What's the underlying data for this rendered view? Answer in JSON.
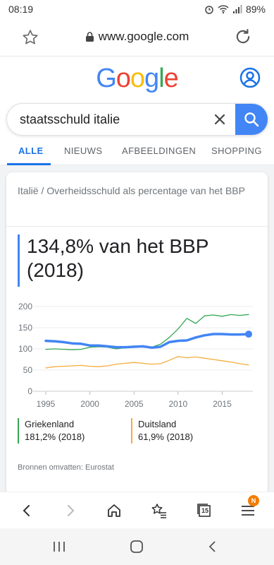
{
  "status": {
    "time": "08:19",
    "battery": "89%"
  },
  "browser": {
    "url": "www.google.com"
  },
  "google": {
    "logo_letters": [
      "G",
      "o",
      "o",
      "g",
      "l",
      "e"
    ],
    "logo_colors": [
      "#4285f4",
      "#ea4335",
      "#fbbc05",
      "#4285f4",
      "#34a853",
      "#ea4335"
    ]
  },
  "search": {
    "query": "staatsschuld italie"
  },
  "tabs": [
    {
      "label": "ALLE",
      "active": true
    },
    {
      "label": "NIEUWS",
      "active": false
    },
    {
      "label": "AFBEELDINGEN",
      "active": false
    },
    {
      "label": "SHOPPING",
      "active": false
    }
  ],
  "card": {
    "breadcrumb": "Italië  /  Overheidsschuld als percentage van het BBP",
    "value_line1": "134,8% van het BBP",
    "value_line2": "(2018)",
    "legend": [
      {
        "name": "Griekenland",
        "value": "181,2% (2018)",
        "color": "#34a853"
      },
      {
        "name": "Duitsland",
        "value": "61,9% (2018)",
        "color": "#f5ac3c"
      }
    ],
    "sources": "Bronnen omvatten: Eurostat"
  },
  "chart_data": {
    "type": "line",
    "x": [
      1995,
      1996,
      1997,
      1998,
      1999,
      2000,
      2001,
      2002,
      2003,
      2004,
      2005,
      2006,
      2007,
      2008,
      2009,
      2010,
      2011,
      2012,
      2013,
      2014,
      2015,
      2016,
      2017,
      2018
    ],
    "series": [
      {
        "name": "Italië",
        "color": "#4285f4",
        "values": [
          119,
          118,
          116,
          113,
          112,
          108,
          108,
          106,
          104,
          104,
          105,
          106,
          103,
          105,
          116,
          119,
          120,
          127,
          132,
          135,
          135,
          134,
          134,
          134.8
        ]
      },
      {
        "name": "Griekenland",
        "color": "#34a853",
        "values": [
          99,
          100,
          99,
          98,
          99,
          104,
          105,
          104,
          100,
          103,
          107,
          104,
          104,
          111,
          127,
          147,
          172,
          160,
          178,
          180,
          177,
          181,
          179,
          181.2
        ]
      },
      {
        "name": "Duitsland",
        "color": "#f5ac3c",
        "values": [
          55,
          58,
          59,
          60,
          61,
          59,
          58,
          60,
          64,
          66,
          68,
          66,
          64,
          65,
          73,
          82,
          79,
          81,
          78,
          75,
          72,
          69,
          65,
          61.9
        ]
      }
    ],
    "xticks": [
      1995,
      2000,
      2005,
      2010,
      2015
    ],
    "yticks": [
      0,
      50,
      100,
      150,
      200
    ],
    "xlim": [
      1995,
      2018
    ],
    "ylim": [
      0,
      200
    ],
    "grid": true
  },
  "toolbar": {
    "tabs_count": "15",
    "menu_badge": "N"
  }
}
